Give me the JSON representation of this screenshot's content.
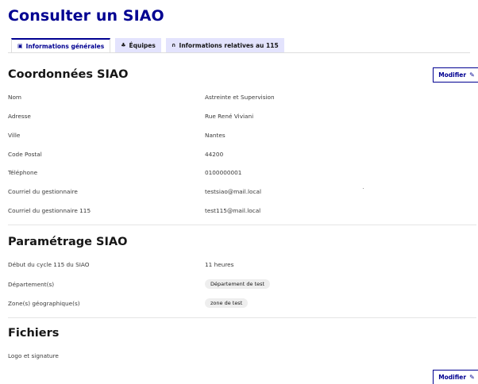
{
  "page": {
    "title": "Consulter un SIAO"
  },
  "tabs": [
    {
      "label": "Informations générales",
      "icon": "document-icon",
      "active": true
    },
    {
      "label": "Équipes",
      "icon": "team-icon",
      "active": false
    },
    {
      "label": "Informations relatives au 115",
      "icon": "headset-icon",
      "active": false
    }
  ],
  "coordonnees": {
    "title": "Coordonnées SIAO",
    "modifier_label": "Modifier",
    "rows": [
      {
        "label": "Nom",
        "value": "Astreinte et Supervision"
      },
      {
        "label": "Adresse",
        "value": "Rue René Viviani"
      },
      {
        "label": "Ville",
        "value": "Nantes"
      },
      {
        "label": "Code Postal",
        "value": "44200"
      },
      {
        "label": "Téléphone",
        "value": "0100000001"
      },
      {
        "label": "Courriel du gestionnaire",
        "value": "testsiao@mail.local"
      },
      {
        "label": "Courriel du gestionnaire 115",
        "value": "test115@mail.local"
      }
    ]
  },
  "parametrage": {
    "title": "Paramétrage SIAO",
    "rows": [
      {
        "label": "Début du cycle 115 du SIAO",
        "value": "11 heures"
      },
      {
        "label": "Département(s)",
        "value": "Département de test"
      },
      {
        "label": "Zone(s) géographique(s)",
        "value": "zone de test"
      }
    ]
  },
  "fichiers": {
    "title": "Fichiers",
    "rows": [
      {
        "label": "Logo et signature"
      }
    ],
    "modifier_label": "Modifier"
  },
  "colors": {
    "primary": "#000091",
    "tab_bg": "#e3e3fd",
    "badge_bg": "#eeeeee"
  }
}
